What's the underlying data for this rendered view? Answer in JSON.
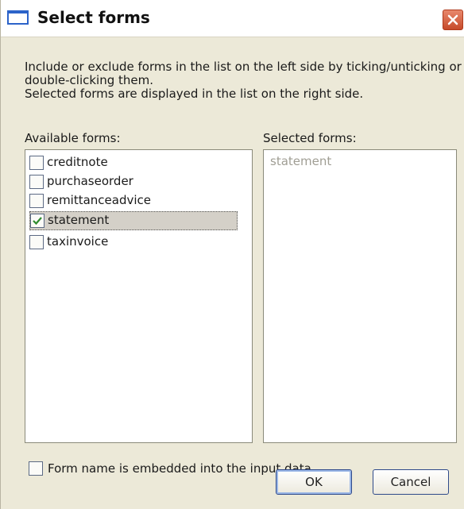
{
  "window": {
    "title": "Select forms"
  },
  "description": {
    "line1": "Include or exclude forms in the list on the left side by ticking/unticking or",
    "line2": "double-clicking them.",
    "line3": "Selected forms are displayed in the list on the right side."
  },
  "available": {
    "label": "Available forms:",
    "items": [
      {
        "label": "creditnote",
        "checked": false
      },
      {
        "label": "purchaseorder",
        "checked": false
      },
      {
        "label": "remittanceadvice",
        "checked": false
      },
      {
        "label": "statement",
        "checked": true
      },
      {
        "label": "taxinvoice",
        "checked": false
      }
    ]
  },
  "selected": {
    "label": "Selected forms:",
    "items": [
      "statement"
    ]
  },
  "embedded_option": {
    "label": "Form name is embedded into the input data",
    "checked": false
  },
  "buttons": {
    "ok": "OK",
    "cancel": "Cancel"
  },
  "colors": {
    "check_mark": "#2e8b2e",
    "title_accent": "#2c63c9"
  }
}
